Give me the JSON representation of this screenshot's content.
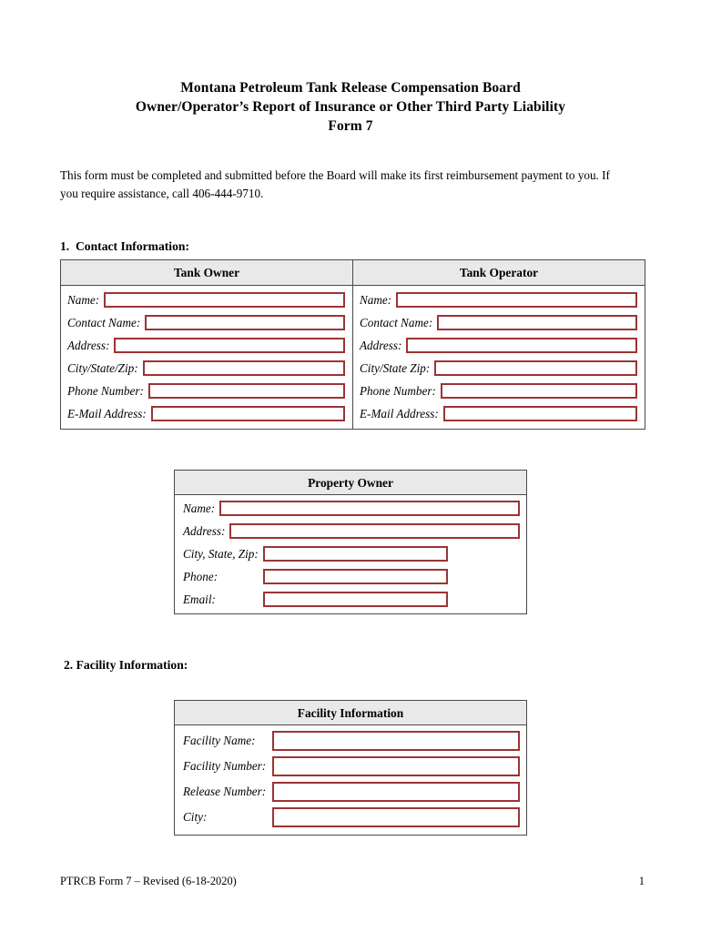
{
  "document": {
    "title_lines": [
      "Montana Petroleum Tank Release Compensation Board",
      "Owner/Operator’s Report of Insurance or Other Third Party Liability",
      "Form 7"
    ],
    "intro": "This form must be completed and submitted before the Board will make its first reimbursement payment to you.  If you require assistance, call 406-444-9710."
  },
  "sections": {
    "contact": {
      "heading": "1.  Contact Information:",
      "columns": [
        {
          "header": "Tank Owner",
          "fields": [
            {
              "label": "Name:",
              "value": ""
            },
            {
              "label": "Contact Name:",
              "value": ""
            },
            {
              "label": "Address:",
              "value": ""
            },
            {
              "label": "City/State/Zip:",
              "value": ""
            },
            {
              "label": "Phone Number:",
              "value": ""
            },
            {
              "label": "E-Mail Address:",
              "value": ""
            }
          ]
        },
        {
          "header": "Tank Operator",
          "fields": [
            {
              "label": "Name:",
              "value": ""
            },
            {
              "label": "Contact Name:",
              "value": ""
            },
            {
              "label": "Address:",
              "value": ""
            },
            {
              "label": "City/State Zip:",
              "value": ""
            },
            {
              "label": "Phone Number:",
              "value": ""
            },
            {
              "label": "E-Mail Address:",
              "value": ""
            }
          ]
        }
      ]
    },
    "property_owner": {
      "header": "Property Owner",
      "fields": [
        {
          "label": "Name:",
          "value": ""
        },
        {
          "label": "Address:",
          "value": ""
        },
        {
          "label": "City, State, Zip:",
          "value": ""
        },
        {
          "label": "Phone:",
          "value": ""
        },
        {
          "label": "Email:",
          "value": ""
        }
      ]
    },
    "facility": {
      "heading": "2. Facility Information:",
      "header": "Facility Information",
      "fields": [
        {
          "label": "Facility Name:",
          "value": ""
        },
        {
          "label": "Facility Number:",
          "value": ""
        },
        {
          "label": "Release Number:",
          "value": ""
        },
        {
          "label": "City:",
          "value": ""
        }
      ]
    }
  },
  "footer": {
    "form_id": "PTRCB Form 7 – Revised (6-18-2020)",
    "page_number": "1"
  },
  "colors": {
    "field_border": "#9c3434",
    "table_border": "#4a4a4a",
    "header_fill": "#e9e9e9"
  }
}
